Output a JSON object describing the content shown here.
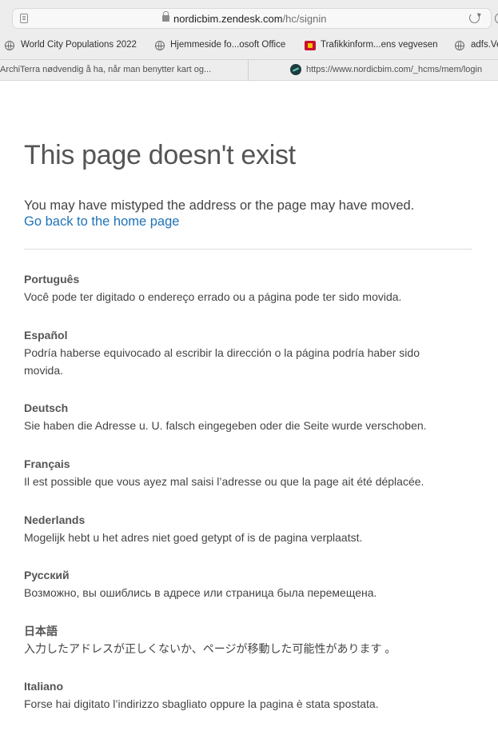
{
  "browser": {
    "url_host": "nordicbim.zendesk.com",
    "url_path": "/hc/signin",
    "bookmarks": [
      {
        "label": "World City Populations 2022",
        "icon": "globe-icon"
      },
      {
        "label": "Hjemmeside fo...osoft Office",
        "icon": "globe-icon"
      },
      {
        "label": "Trafikkinform...ens vegvesen",
        "icon": "flag-icon"
      },
      {
        "label": "adfs.Ve",
        "icon": "globe-icon"
      }
    ],
    "tabs": [
      {
        "label": "ArchiTerra nødvendig å ha, når man benytter kart og..."
      },
      {
        "label": "https://www.nordicbim.com/_hcms/mem/login"
      }
    ]
  },
  "page": {
    "title": "This page doesn't exist",
    "intro": "You may have mistyped the address or the page may have moved.",
    "home_link": "Go back to the home page"
  },
  "languages": [
    {
      "name": "Português",
      "message": "Você pode ter digitado o endereço errado ou a página pode ter sido movida."
    },
    {
      "name": "Español",
      "message": "Podría haberse equivocado al escribir la dirección o la página podría haber sido movida."
    },
    {
      "name": "Deutsch",
      "message": "Sie haben die Adresse u. U. falsch eingegeben oder die Seite wurde verschoben."
    },
    {
      "name": "Français",
      "message": "Il est possible que vous ayez mal saisi l’adresse ou que la page ait été déplacée."
    },
    {
      "name": "Nederlands",
      "message": "Mogelijk hebt u het adres niet goed getypt of is de pagina verplaatst."
    },
    {
      "name": "Русский",
      "message": "Возможно, вы ошиблись в адресе или страница была перемещена."
    },
    {
      "name": "日本語",
      "message": "入力したアドレスが正しくないか、ページが移動した可能性があります 。"
    },
    {
      "name": "Italiano",
      "message": "Forse hai digitato l’indirizzo sbagliato oppure la pagina è stata spostata."
    }
  ],
  "colors": {
    "link": "#1f73b7",
    "title": "#555555",
    "text": "#444444"
  }
}
